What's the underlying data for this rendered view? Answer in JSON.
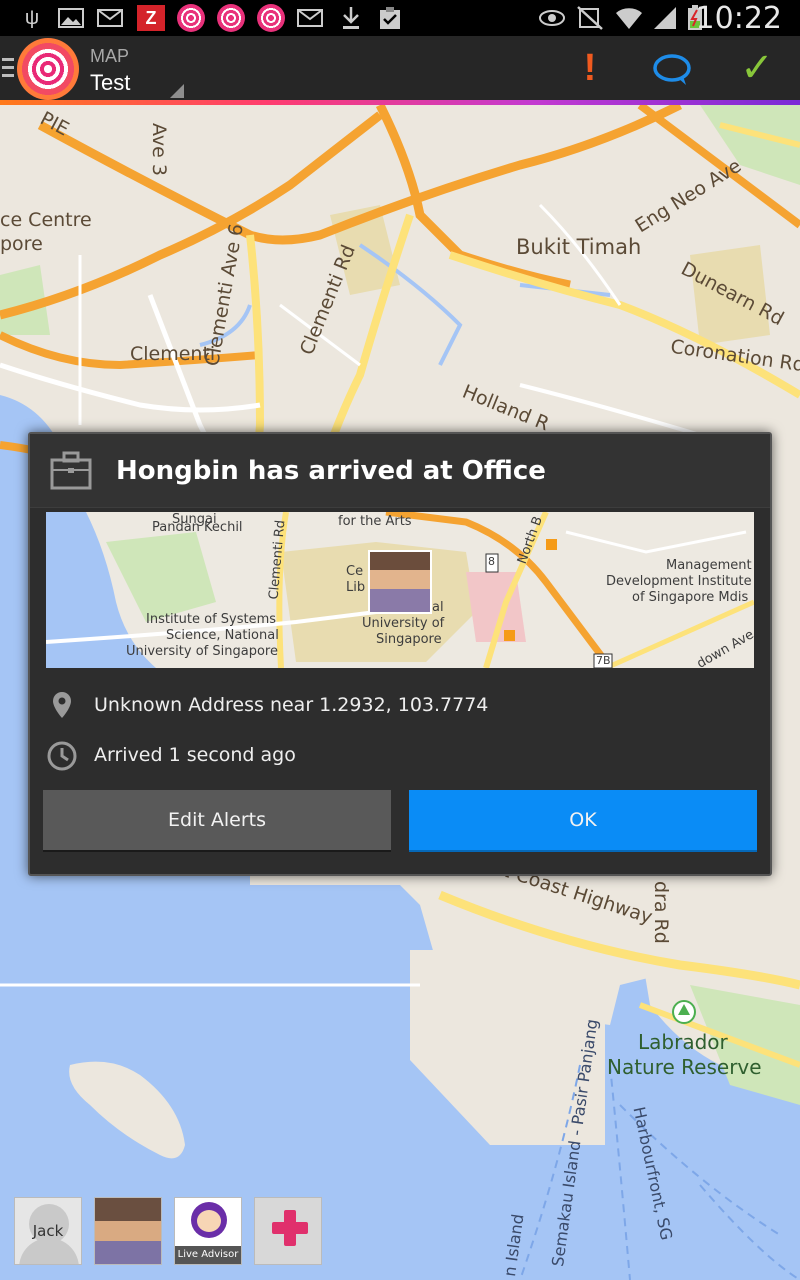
{
  "status_bar": {
    "time": "10:22",
    "icons": [
      "usb-icon",
      "image-icon",
      "email-icon",
      "zinio-icon",
      "life360-icon",
      "life360-icon",
      "life360-icon",
      "email-icon",
      "download-icon",
      "clipboard-icon",
      "eye-icon",
      "mute-icon",
      "wifi-icon",
      "signal-icon",
      "battery-icon"
    ]
  },
  "action_bar": {
    "subtitle": "MAP",
    "title": "Test",
    "icons": [
      "alert-icon",
      "chat-icon",
      "check-icon"
    ]
  },
  "map": {
    "labels": {
      "pie": "PIE",
      "ave3": "Ave 3",
      "centre": "ce Centre",
      "pore": "pore",
      "bukit_timah": "Bukit Timah",
      "eng_neo": "Eng Neo Ave",
      "dunearn": "Dunearn Rd",
      "clementi": "Clementi",
      "clementi_ave6": "Clementi Ave 6",
      "clementi_rd": "Clementi Rd",
      "coronation": "Coronation Rd",
      "holland": "Holland R",
      "coast_hwy": "t Coast Highway",
      "labrador": "Labrador",
      "nature_reserve": "Nature Reserve",
      "semakau": "Semakau Island - Pasir Panjang",
      "harbourfront": "Harbourfront, SG",
      "island": "n Island",
      "dra_rd": "dra Rd"
    }
  },
  "dialog": {
    "title": "Hongbin has arrived at Office",
    "address": "Unknown Address near 1.2932, 103.7774",
    "time": "Arrived 1 second ago",
    "edit_button": "Edit Alerts",
    "ok_button": "OK",
    "minimap_labels": {
      "for_the_arts": "for the Arts",
      "sungai": "Sungai",
      "pandan_kechil": "Pandan Kechil",
      "clementi_rd": "Clementi Rd",
      "north_b": "North B",
      "ce": "Ce",
      "lib": "Lib",
      "al": "al",
      "institute": "Institute of Systems",
      "science": "Science, National",
      "univ_sg": "University of Singapore",
      "univ": "University of",
      "singapore": "Singapore",
      "management": "Management",
      "dev_inst": "Development Institute",
      "of_sg": "of Singapore Mdis",
      "n8": "8",
      "n7b": "7B",
      "down_ave": "down Ave"
    }
  },
  "tray": {
    "jack_label": "Jack",
    "advisor_label": "Live Advisor"
  },
  "colors": {
    "ok_button": "#0a8cf6",
    "edit_button": "#595959",
    "alert": "#f05a1f",
    "check": "#88c63a",
    "chat": "#1e8ce8",
    "brand": "#e92a77"
  }
}
